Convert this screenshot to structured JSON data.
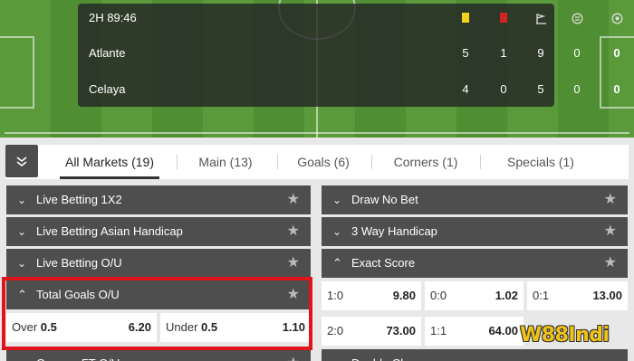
{
  "scoreboard": {
    "clock": "2H 89:46",
    "icons": [
      "yellow-card-icon",
      "red-card-icon",
      "corner-flag-icon",
      "substitution-icon",
      "ball-icon"
    ],
    "teams": [
      {
        "name": "Atlante",
        "yellow": "5",
        "red": "1",
        "corners": "9",
        "subs": "0",
        "goals": "0"
      },
      {
        "name": "Celaya",
        "yellow": "4",
        "red": "0",
        "corners": "5",
        "subs": "0",
        "goals": "0"
      }
    ]
  },
  "tabs": [
    {
      "label": "All Markets (19)",
      "active": true
    },
    {
      "label": "Main (13)",
      "active": false
    },
    {
      "label": "Goals (6)",
      "active": false
    },
    {
      "label": "Corners (1)",
      "active": false
    },
    {
      "label": "Specials (1)",
      "active": false
    }
  ],
  "markets": {
    "left": [
      {
        "title": "Live Betting 1X2",
        "expanded": false
      },
      {
        "title": "Live Betting Asian Handicap",
        "expanded": false
      },
      {
        "title": "Live Betting O/U",
        "expanded": false
      },
      {
        "title": "Total Goals O/U",
        "expanded": true
      },
      {
        "title": "Corners FT O/U",
        "expanded": false
      }
    ],
    "right": [
      {
        "title": "Draw No Bet",
        "expanded": false
      },
      {
        "title": "3 Way Handicap",
        "expanded": false
      },
      {
        "title": "Exact Score",
        "expanded": true
      },
      {
        "title": "Double Chance",
        "expanded": false
      }
    ]
  },
  "total_goals": {
    "over_label": "Over",
    "over_line": "0.5",
    "over_odds": "6.20",
    "under_label": "Under",
    "under_line": "0.5",
    "under_odds": "1.10"
  },
  "exact_score": [
    {
      "score": "1:0",
      "odds": "9.80"
    },
    {
      "score": "0:0",
      "odds": "1.02"
    },
    {
      "score": "0:1",
      "odds": "13.00"
    },
    {
      "score": "2:0",
      "odds": "73.00"
    },
    {
      "score": "1:1",
      "odds": "64.00"
    }
  ],
  "watermark": "W88Indi",
  "colors": {
    "highlight": "#e0141a",
    "header_bg": "#4e4e4e",
    "yellow_card": "#f3d21c",
    "red_card": "#d32424"
  }
}
